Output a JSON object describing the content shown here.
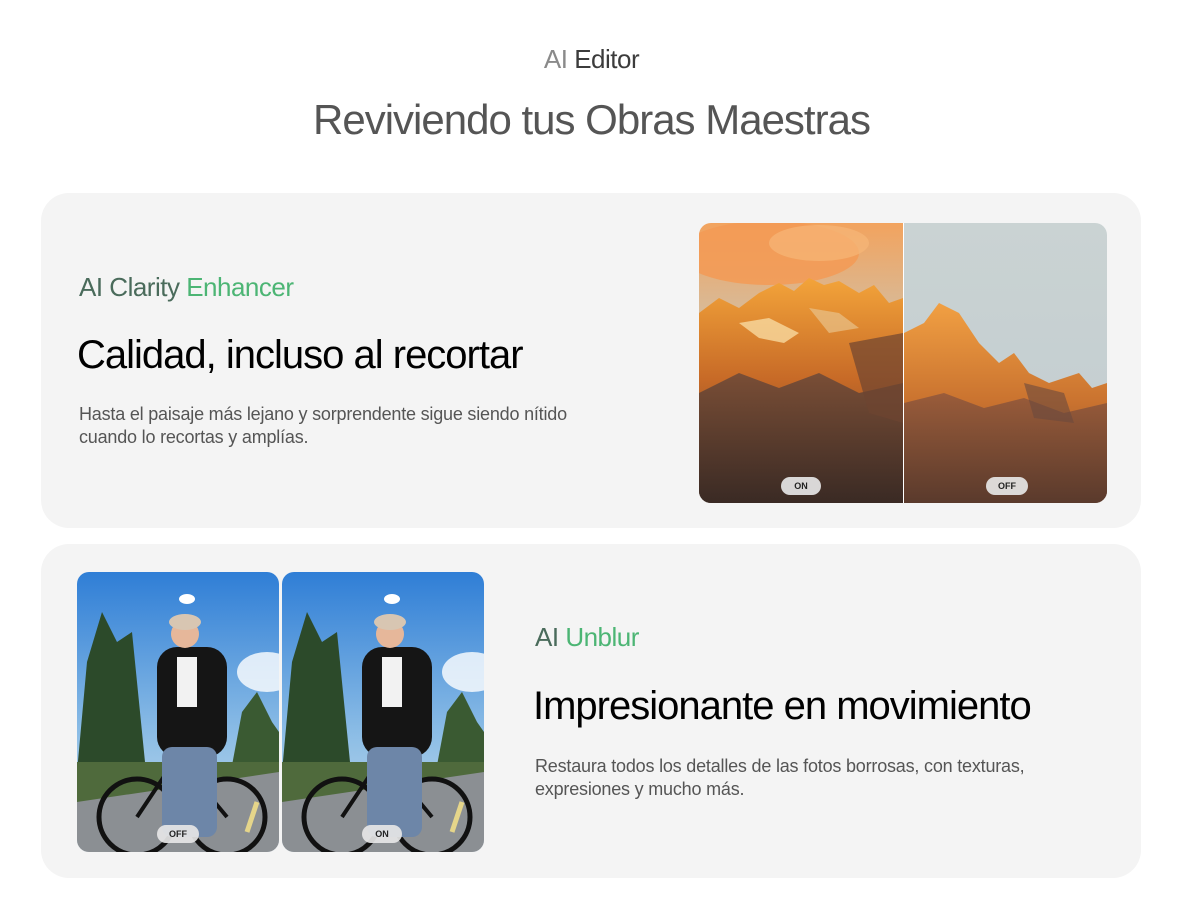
{
  "header": {
    "eyebrow_part1": "AI",
    "eyebrow_part2": "Editor",
    "headline": "Reviviendo tus Obras Maestras"
  },
  "features": [
    {
      "tag_prefix": "AI Clarity",
      "tag_highlight": "Enhancer",
      "title": "Calidad, incluso al recortar",
      "description": "Hasta el paisaje más lejano y sorprendente sigue siendo nítido cuando lo recortas y amplías.",
      "compare_labels": {
        "left": "ON",
        "right": "OFF"
      }
    },
    {
      "tag_prefix": "AI",
      "tag_highlight": "Unblur",
      "title": "Impresionante en movimiento",
      "description": "Restaura todos los detalles de las fotos borrosas, con texturas, expresiones y mucho más.",
      "compare_labels": {
        "left": "OFF",
        "right": "ON"
      }
    }
  ],
  "colors": {
    "tag_dark_green": "#4a6b5b",
    "tag_bright_green": "#4cb574",
    "card_background": "#f4f4f4"
  }
}
